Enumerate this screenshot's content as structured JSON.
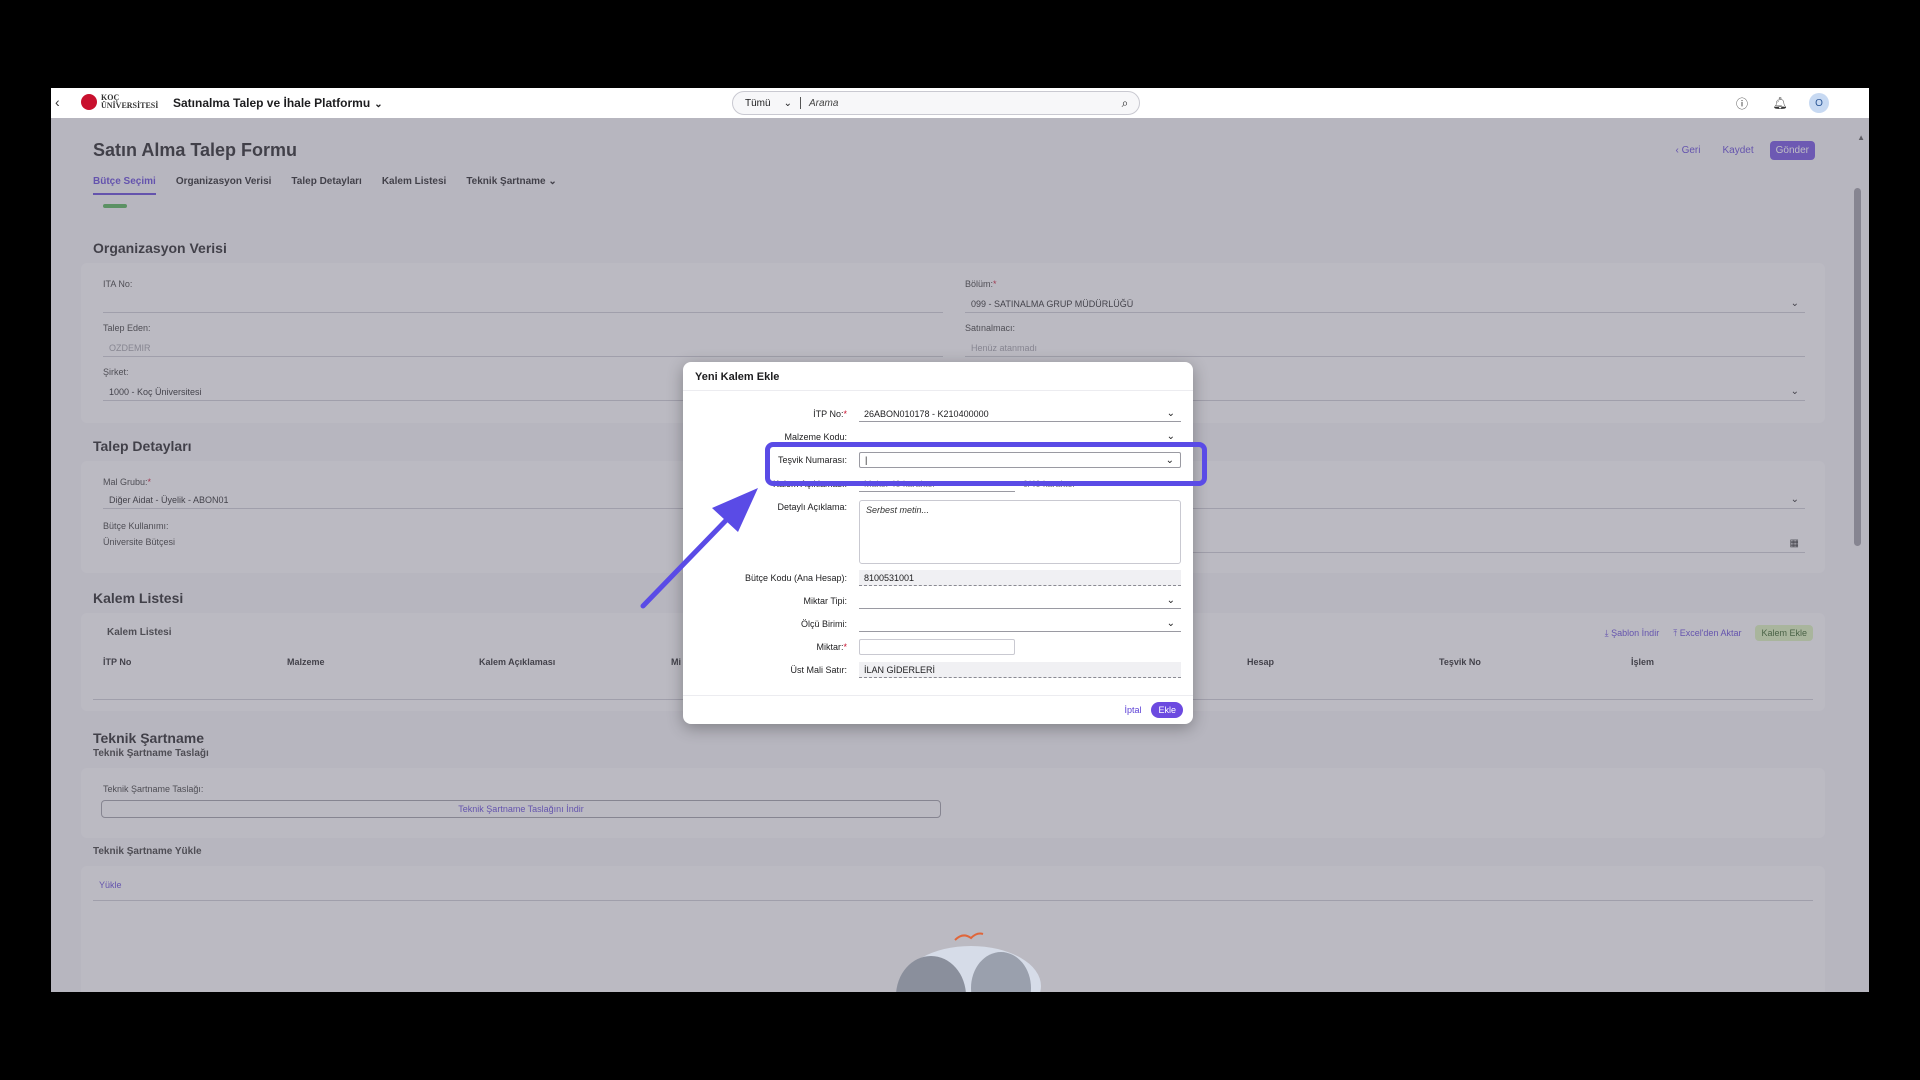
{
  "shell": {
    "logo_text": "KOÇ ÜNİVERSİTESİ",
    "app_title": "Satınalma Talep ve İhale Platformu",
    "search_scope": "Tümü",
    "search_placeholder": "Arama",
    "avatar_initial": "O"
  },
  "header": {
    "title": "Satın Alma Talep Formu",
    "back_label": "Geri",
    "save_label": "Kaydet",
    "send_label": "Gönder",
    "tabs": [
      "Bütçe Seçimi",
      "Organizasyon Verisi",
      "Talep Detayları",
      "Kalem Listesi",
      "Teknik Şartname"
    ]
  },
  "org": {
    "heading": "Organizasyon Verisi",
    "ita_label": "ITA No:",
    "ita_value": "",
    "bolum_label": "Bölüm:",
    "bolum_value": "099 - SATINALMA GRUP MÜDÜRLÜĞÜ",
    "talep_eden_label": "Talep Eden:",
    "talep_eden_value": "OZDEMIR",
    "satinalmaci_label": "Satınalmacı:",
    "satinalmaci_value": "Henüz atanmadı",
    "sirket_label": "Şirket:",
    "sirket_value": "1000 - Koç Üniversitesi"
  },
  "talep": {
    "heading": "Talep Detayları",
    "mal_grubu_label": "Mal Grubu:",
    "mal_grubu_value": "Diğer Aidat - Üyelik - ABON01",
    "butce_kullanimi_label": "Bütçe Kullanımı:",
    "butce_kullanimi_value": "Üniversite Bütçesi"
  },
  "kalem": {
    "heading": "Kalem Listesi",
    "card_title": "Kalem Listesi",
    "sablon_label": "Şablon İndir",
    "excel_label": "Excel'den Aktar",
    "kalem_ekle_label": "Kalem Ekle",
    "columns": [
      "İTP No",
      "Malzeme",
      "Kalem Açıklaması",
      "Mi",
      "Hesap",
      "Teşvik No",
      "İşlem"
    ]
  },
  "teknik": {
    "heading": "Teknik Şartname",
    "subheading": "Teknik Şartname Taslağı",
    "taslak_label": "Teknik Şartname Taslağı:",
    "taslak_button": "Teknik Şartname Taslağını İndir",
    "yukle_heading": "Teknik Şartname Yükle",
    "yukle_tab": "Yükle"
  },
  "dialog": {
    "title": "Yeni Kalem Ekle",
    "itp_label": "İTP No:",
    "itp_value": "26ABON010178 - K210400000",
    "malzeme_label": "Malzeme Kodu:",
    "tesvik_label": "Teşvik Numarası:",
    "kalem_aciklamasi_label": "Kalem Açıklaması:",
    "kalem_aciklamasi_placeholder": "Maks. 40 karakter",
    "char_count": "0/40 karakter",
    "detayli_label": "Detaylı Açıklama:",
    "detayli_placeholder": "Serbest metin...",
    "butce_kodu_label": "Bütçe Kodu (Ana Hesap):",
    "butce_kodu_value": "8100531001",
    "miktar_tipi_label": "Miktar Tipi:",
    "olcu_birimi_label": "Ölçü Birimi:",
    "miktar_label": "Miktar:",
    "ust_mali_label": "Üst Mali Satır:",
    "ust_mali_value": "İLAN GİDERLERİ",
    "cancel_label": "İptal",
    "add_label": "Ekle"
  },
  "colors": {
    "accent": "#6c4ae0",
    "highlight": "#5a4be6",
    "required": "#c8102e"
  }
}
